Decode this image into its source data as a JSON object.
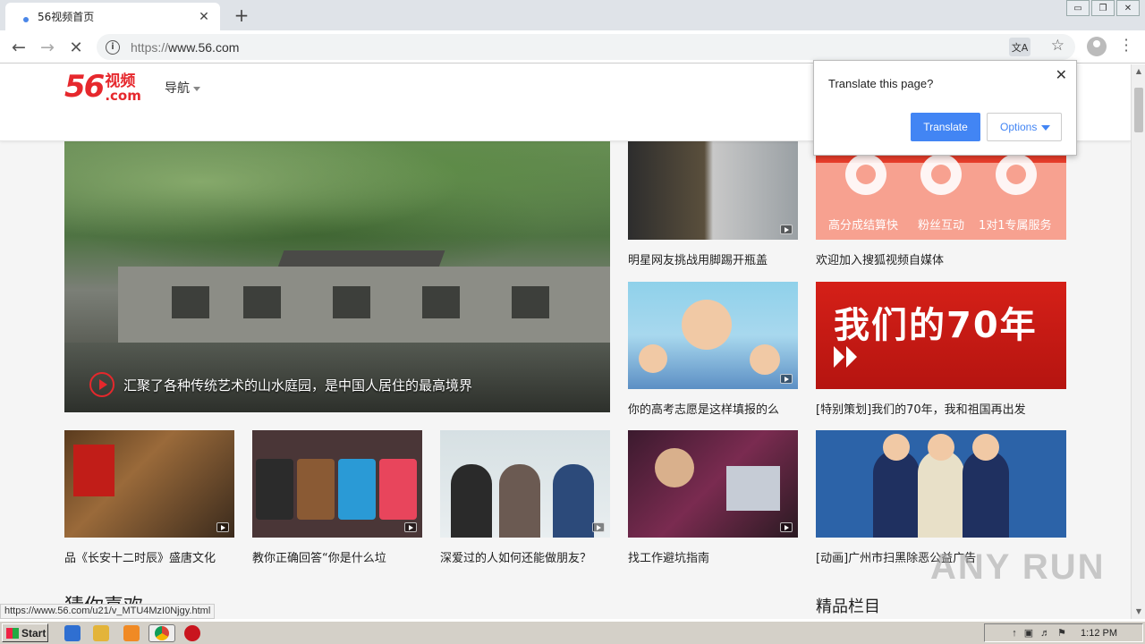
{
  "browser": {
    "tab_title": "56视频首页",
    "tab_close": "✕",
    "new_tab": "+",
    "url_scheme": "https://",
    "url_host": "www.56.com",
    "window_controls": [
      "▭",
      "❐",
      "✕"
    ]
  },
  "site": {
    "logo_number": "56",
    "logo_text": "视频",
    "logo_com": ".com",
    "nav_label": "导航"
  },
  "hero": {
    "caption": "汇聚了各种传统艺术的山水庭园，是中国人居住的最高境界"
  },
  "cards": [
    {
      "title": "明星网友挑战用脚踢开瓶盖"
    },
    {
      "title": "欢迎加入搜狐视频自媒体"
    },
    {
      "title": "你的高考志愿是这样填报的么"
    },
    {
      "title": "[特别策划]我们的70年，我和祖国再出发"
    },
    {
      "title": "品《长安十二时辰》盛唐文化"
    },
    {
      "title": "教你正确回答“你是什么垃"
    },
    {
      "title": "深爱过的人如何还能做朋友？"
    },
    {
      "title": "找工作避坑指南"
    },
    {
      "title": "[动画]广州市扫黑除恶公益广告"
    }
  ],
  "promo": {
    "labels": [
      "高分成结算快",
      "粉丝互动",
      "1对1专属服务"
    ]
  },
  "banner70": {
    "text": "我们的70年"
  },
  "sections": {
    "left_title": "猜你喜欢",
    "right_title": "精品栏目"
  },
  "translate_popup": {
    "question": "Translate this page?",
    "translate_btn": "Translate",
    "options_btn": "Options",
    "close": "✕"
  },
  "status_url": "https://www.56.com/u21/v_MTU4MzI0Njgy.html",
  "watermark": "ANY RUN",
  "taskbar": {
    "start": "Start",
    "clock": "1:12 PM"
  },
  "colors": {
    "brand_red": "#e6282d",
    "translate_blue": "#4285f4"
  },
  "icons": [
    "back-arrow-icon",
    "forward-arrow-icon",
    "reload-icon",
    "info-icon",
    "translate-icon",
    "star-icon",
    "profile-icon",
    "menu-icon",
    "play-icon",
    "video-badge-icon"
  ]
}
